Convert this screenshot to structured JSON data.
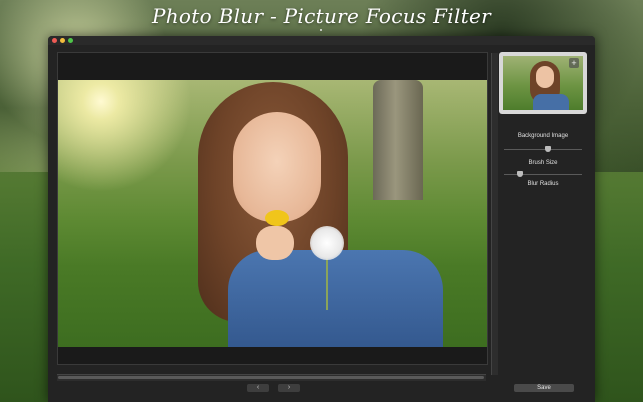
{
  "promo": {
    "title": "Photo Blur - Picture Focus Filter"
  },
  "window": {
    "traffic_lights": [
      "close",
      "minimize",
      "zoom"
    ]
  },
  "nav": {
    "prev_label": "‹",
    "next_label": "›"
  },
  "sidebar": {
    "background_image_label": "Background Image",
    "add_icon": "plus-icon",
    "brush_size_label": "Brush Size",
    "blur_radius_label": "Blur Radius",
    "brush_size_value": 0.54,
    "blur_radius_value": 0.18
  },
  "actions": {
    "save_label": "Save"
  },
  "colors": {
    "title_text": "#ffffff",
    "window_bg": "#232323",
    "panel_text": "#e0e0e0"
  }
}
